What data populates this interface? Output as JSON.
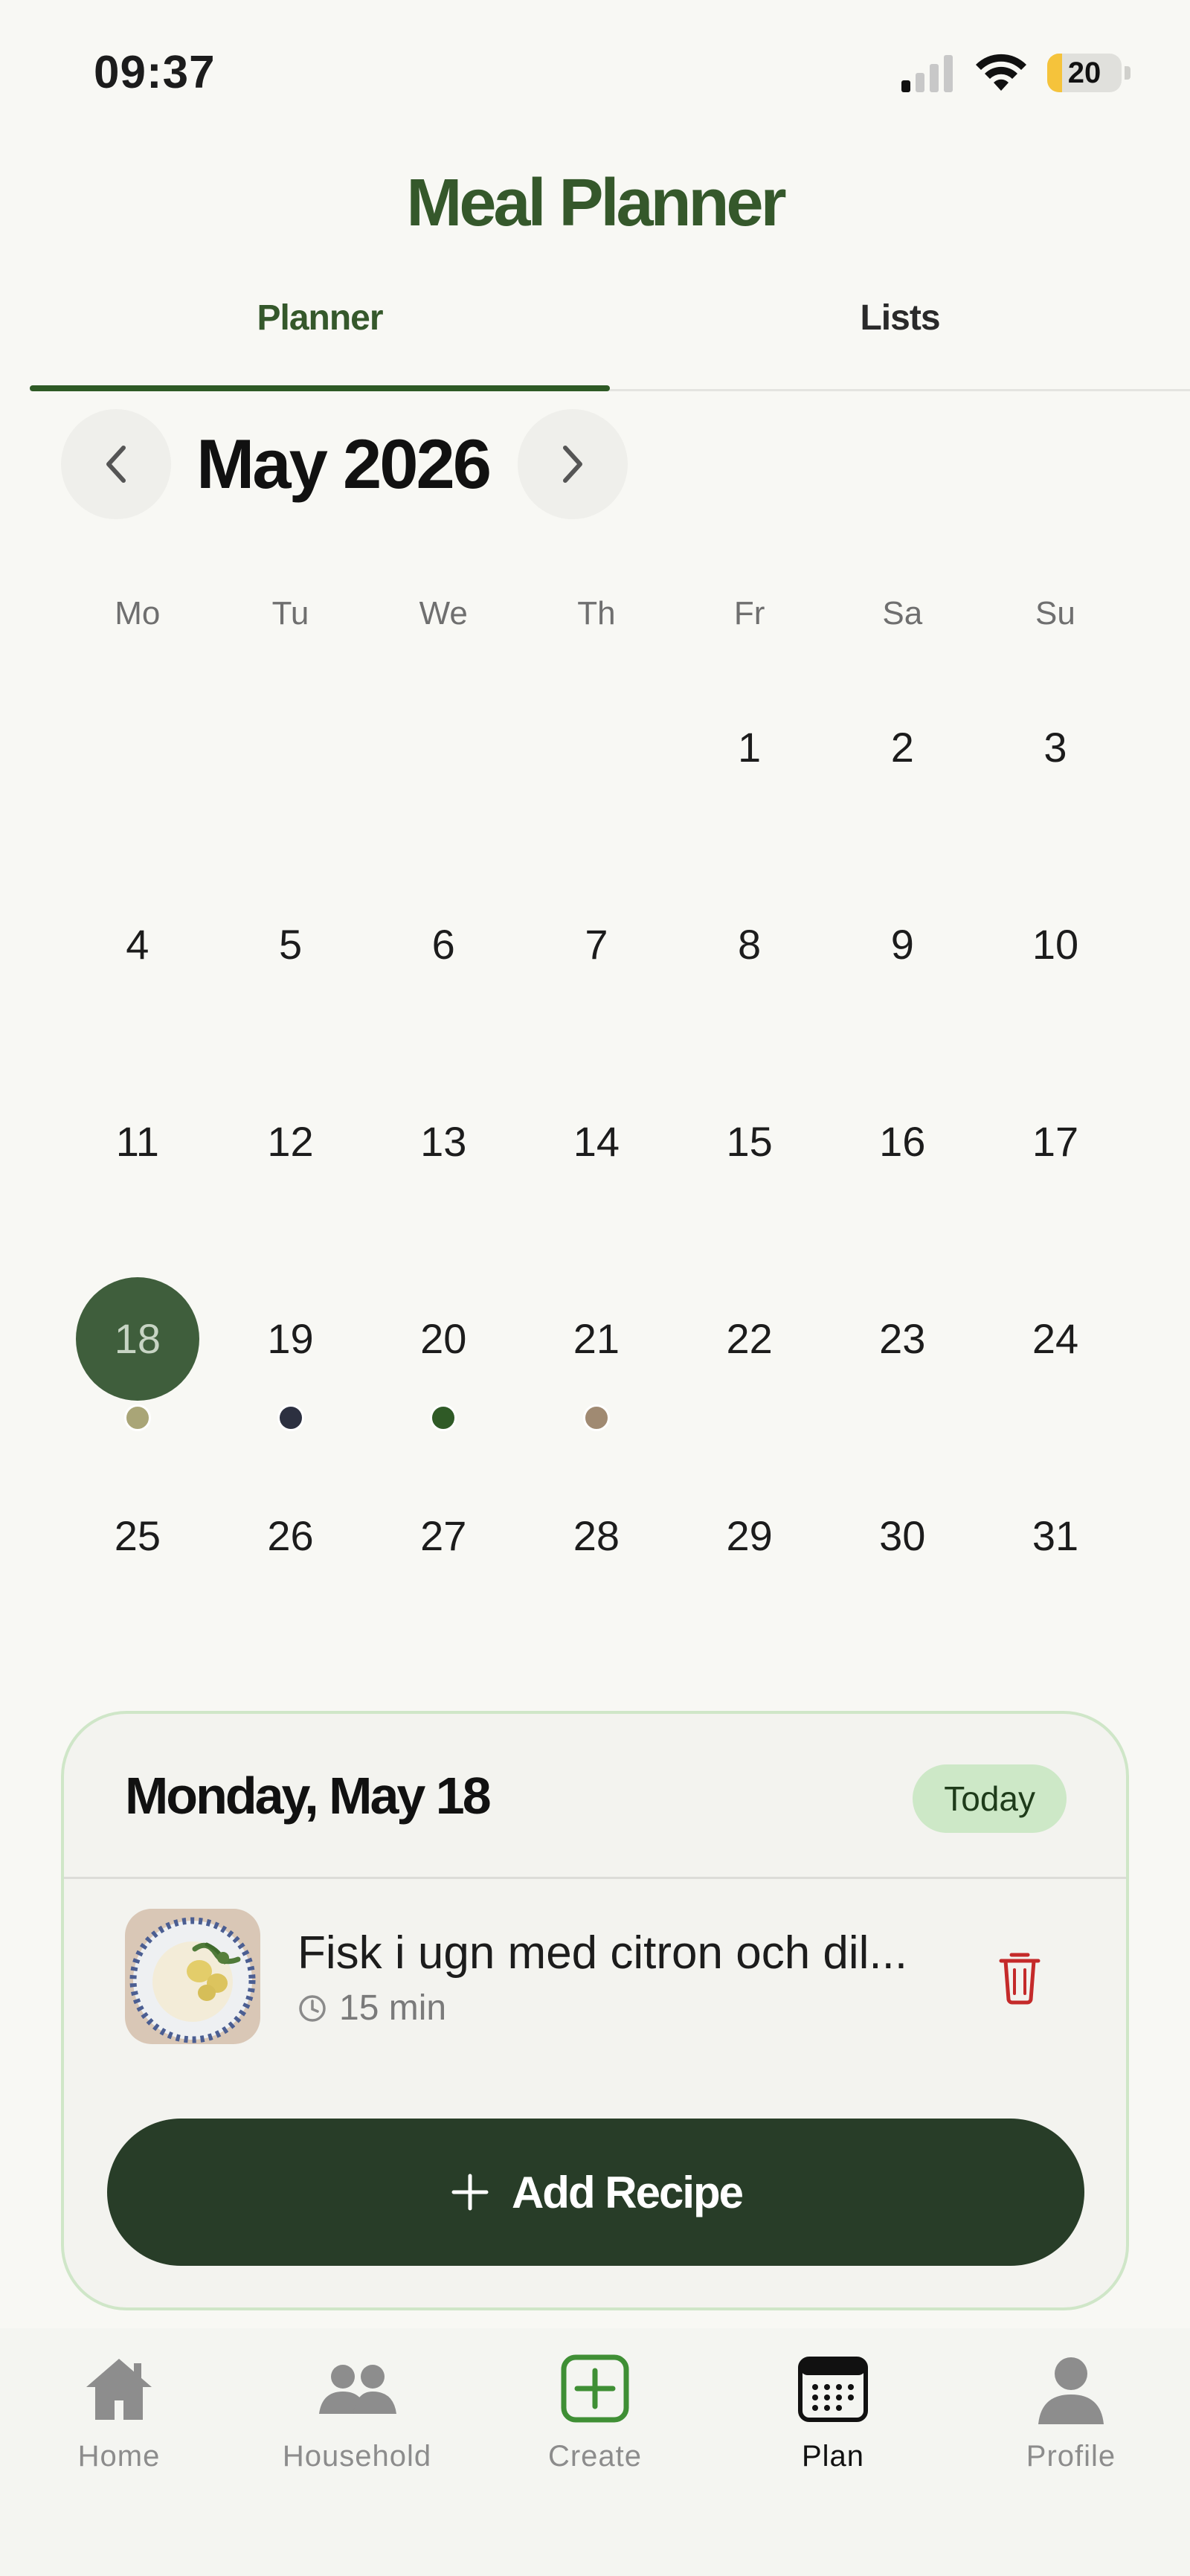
{
  "status_bar": {
    "time": "09:37",
    "battery_level": "20"
  },
  "header": {
    "title": "Meal Planner"
  },
  "tabs": [
    {
      "label": "Planner",
      "active": true
    },
    {
      "label": "Lists",
      "active": false
    }
  ],
  "calendar": {
    "month_label": "May 2026",
    "weekdays": [
      "Mo",
      "Tu",
      "We",
      "Th",
      "Fr",
      "Sa",
      "Su"
    ],
    "selected_day": "18",
    "weeks": [
      [
        "",
        "",
        "",
        "",
        "1",
        "2",
        "3"
      ],
      [
        "4",
        "5",
        "6",
        "7",
        "8",
        "9",
        "10"
      ],
      [
        "11",
        "12",
        "13",
        "14",
        "15",
        "16",
        "17"
      ],
      [
        "18",
        "19",
        "20",
        "21",
        "22",
        "23",
        "24"
      ],
      [
        "25",
        "26",
        "27",
        "28",
        "29",
        "30",
        "31"
      ]
    ],
    "meal_dots": {
      "18": "#a9a577",
      "19": "#2c3040",
      "20": "#2f5a26",
      "21": "#a08a72"
    }
  },
  "day_card": {
    "date_label": "Monday, May 18",
    "today_badge": "Today",
    "recipe": {
      "title": "Fisk i ugn med citron och dil...",
      "duration": "15 min"
    },
    "add_button_label": "Add Recipe"
  },
  "bottom_nav": {
    "items": [
      {
        "key": "home",
        "label": "Home",
        "icon": "home-icon"
      },
      {
        "key": "household",
        "label": "Household",
        "icon": "household-icon"
      },
      {
        "key": "create",
        "label": "Create",
        "icon": "create-icon"
      },
      {
        "key": "plan",
        "label": "Plan",
        "icon": "calendar-icon",
        "active": true
      },
      {
        "key": "profile",
        "label": "Profile",
        "icon": "profile-icon"
      }
    ]
  },
  "colors": {
    "brand_green": "#35582b",
    "selected_day": "#3f5e3c",
    "button_dark": "#283d28",
    "today_badge": "#cde8c7",
    "delete_red": "#c42a2a"
  }
}
